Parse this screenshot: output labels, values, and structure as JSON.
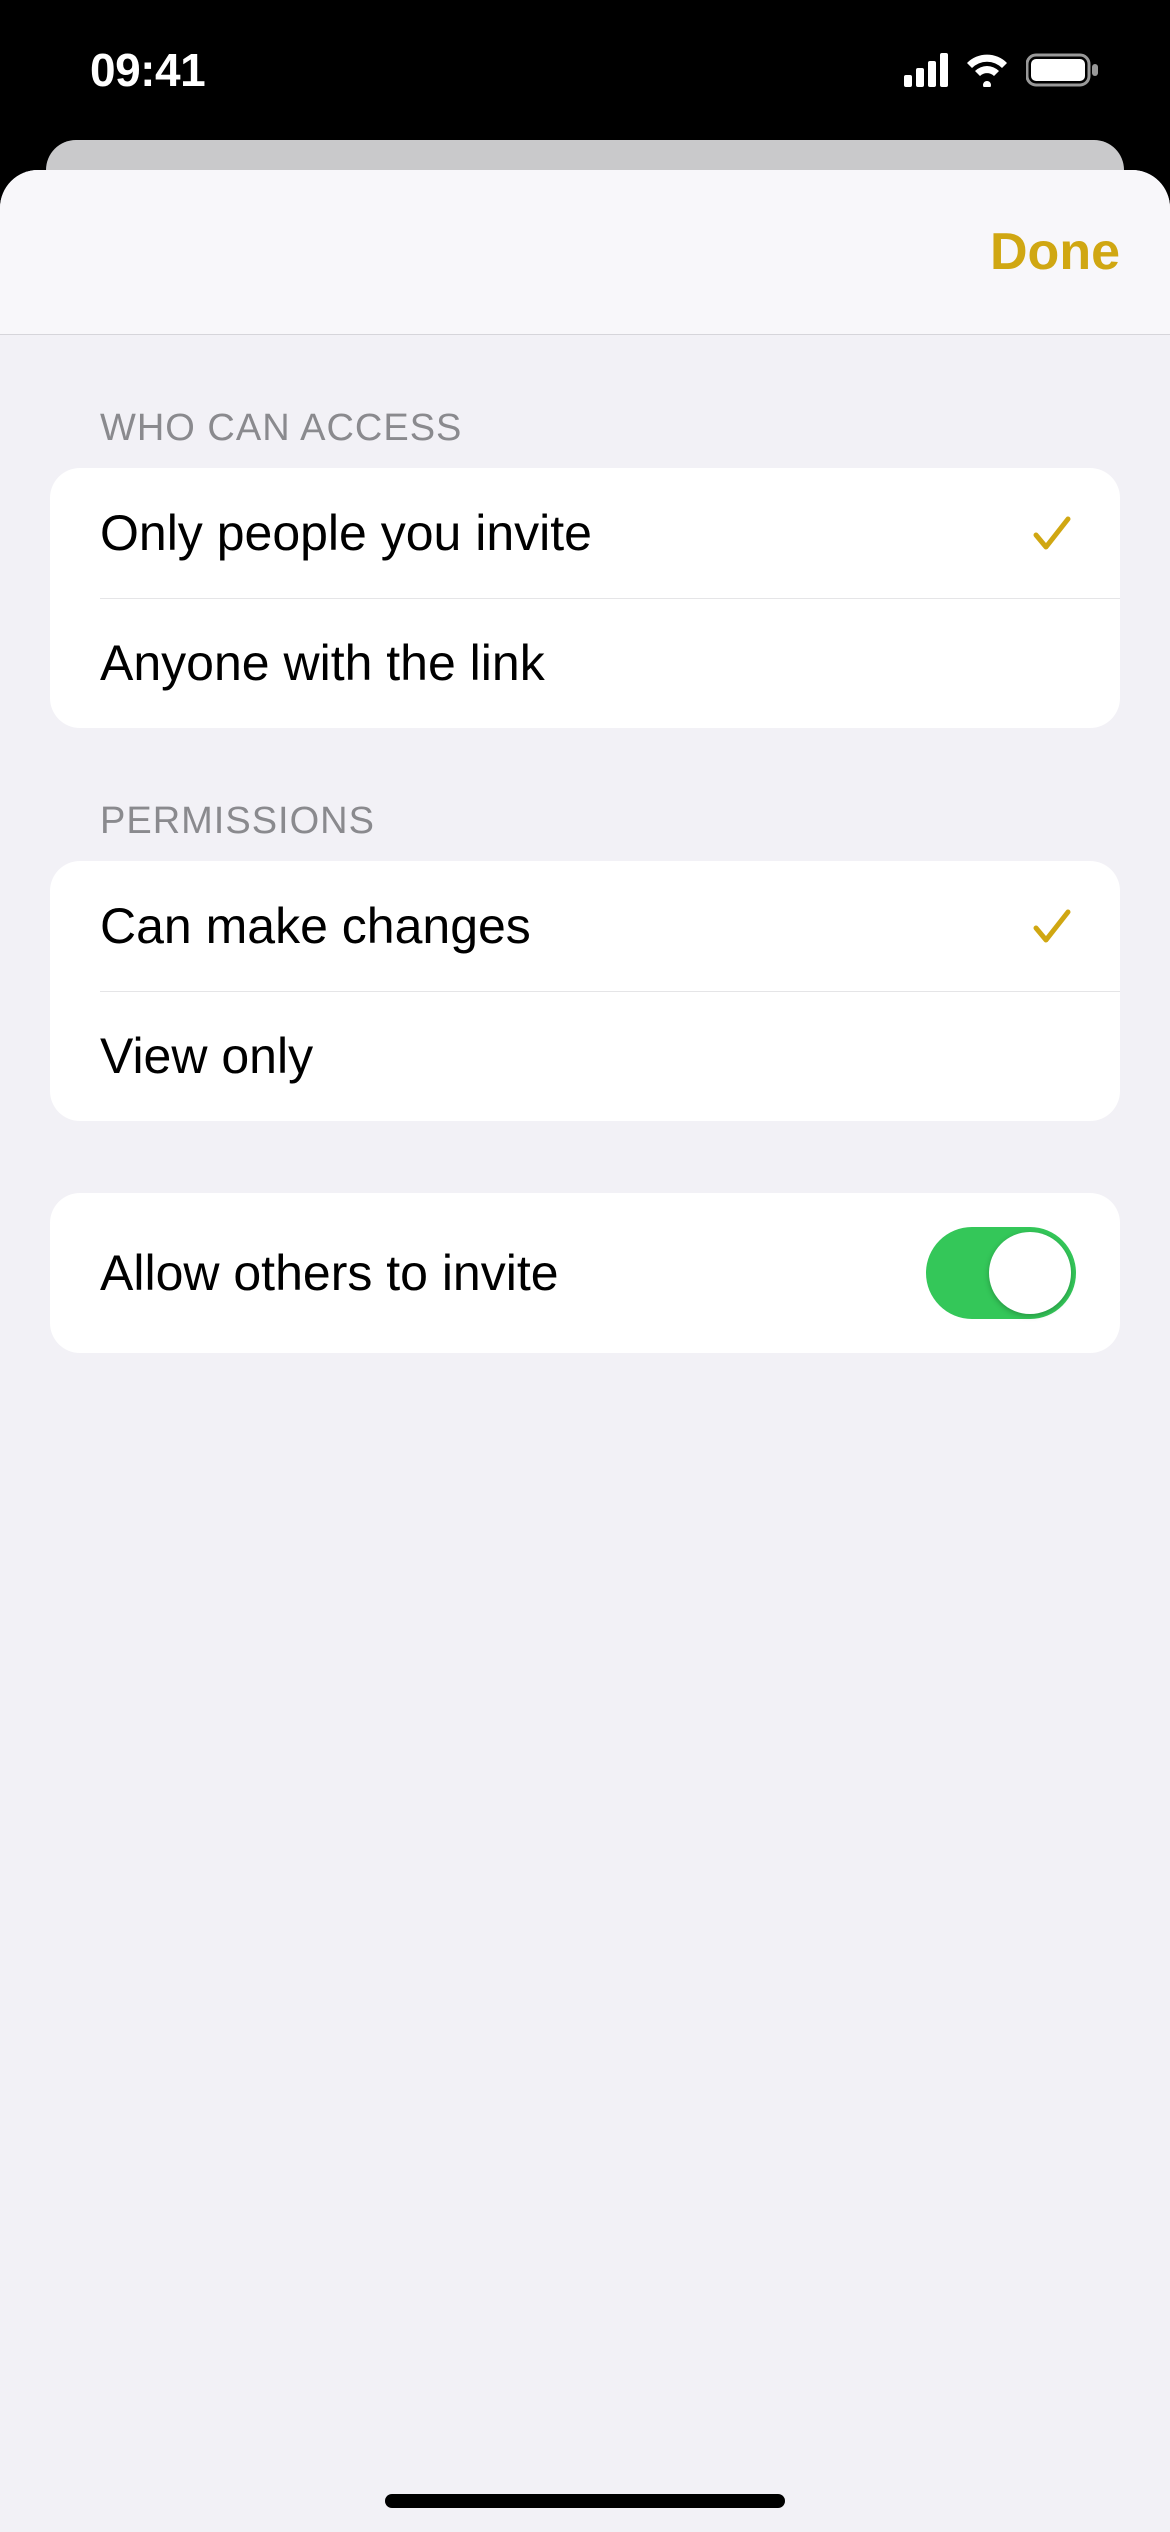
{
  "status": {
    "time": "09:41"
  },
  "modal": {
    "done_label": "Done"
  },
  "sections": {
    "access": {
      "header": "WHO CAN ACCESS",
      "options": [
        {
          "label": "Only people you invite",
          "selected": true
        },
        {
          "label": "Anyone with the link",
          "selected": false
        }
      ]
    },
    "permissions": {
      "header": "PERMISSIONS",
      "options": [
        {
          "label": "Can make changes",
          "selected": true
        },
        {
          "label": "View only",
          "selected": false
        }
      ]
    },
    "invite": {
      "label": "Allow others to invite",
      "enabled": true
    }
  }
}
